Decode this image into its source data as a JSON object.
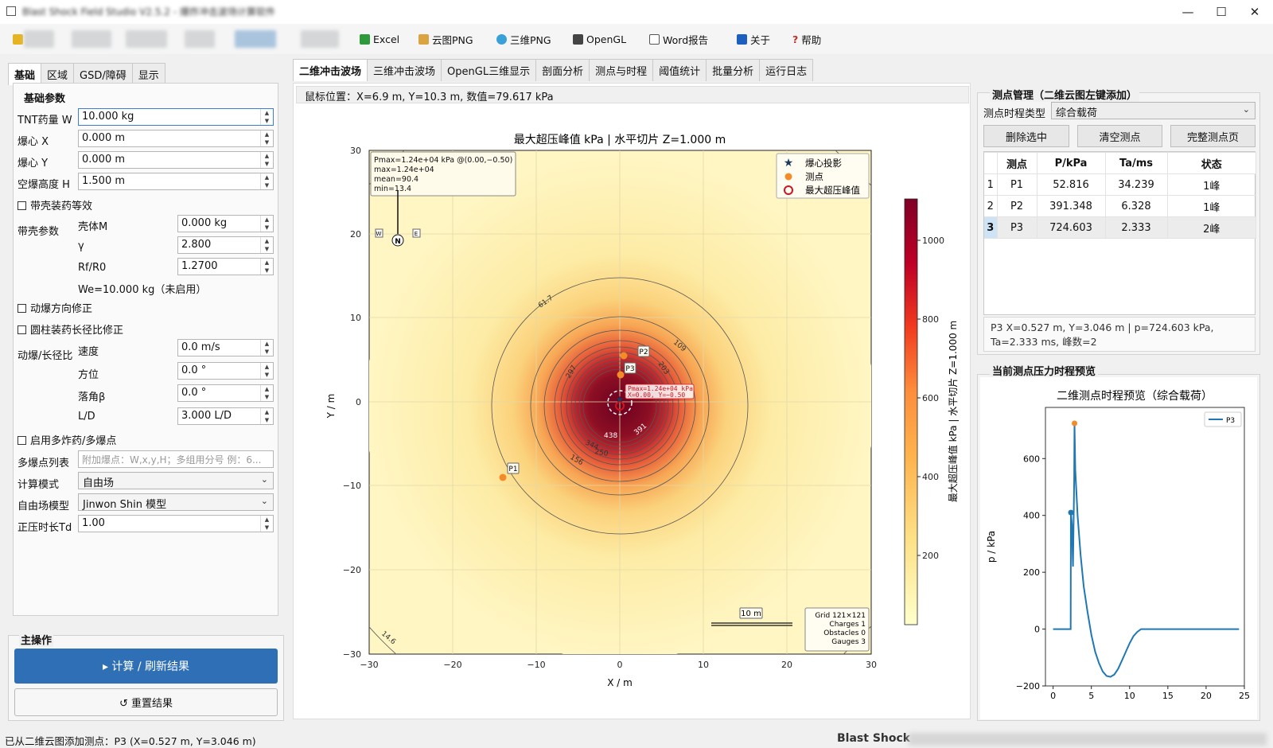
{
  "window": {
    "title": "Blast Shock Field Studio V2.5.2 - 爆炸冲击波场计算软件",
    "minimize": "—",
    "maximize": "☐",
    "close": "✕"
  },
  "toolbar": {
    "items": [
      "Excel",
      "云图PNG",
      "三维PNG",
      "OpenGL",
      "Word报告",
      "关于",
      "帮助"
    ]
  },
  "left": {
    "tabs": [
      "基础",
      "区域",
      "GSD/障碍",
      "显示"
    ],
    "group_basic": "基础参数",
    "tnt_label": "TNT药量 W",
    "tnt_value": "10.000 kg",
    "cx_label": "爆心 X",
    "cx_value": "0.000 m",
    "cy_label": "爆心 Y",
    "cy_value": "0.000 m",
    "h_label": "空爆高度 H",
    "h_value": "1.500 m",
    "shell_cb": "带壳装药等效",
    "shell_params": "带壳参数",
    "shell_m_label": "壳体M",
    "shell_m_value": "0.000 kg",
    "gamma_label": "γ",
    "gamma_value": "2.800",
    "rf_label": "Rf/R0",
    "rf_value": "1.2700",
    "we_text": "We=10.000 kg（未启用）",
    "dyn_cb": "动爆方向修正",
    "cyl_cb": "圆柱装药长径比修正",
    "dyn_group": "动爆/长径比",
    "speed_label": "速度",
    "speed_value": "0.0 m/s",
    "azimuth_label": "方位",
    "azimuth_value": "0.0 °",
    "fall_label": "落角β",
    "fall_value": "0.0 °",
    "ld_label": "L/D",
    "ld_value": "3.000 L/D",
    "multi_cb": "启用多炸药/多爆点",
    "multi_list_label": "多爆点列表",
    "multi_list_placeholder": "附加爆点：W,x,y,H；多组用分号 例：6...",
    "calc_mode_label": "计算模式",
    "calc_mode_value": "自由场",
    "free_model_label": "自由场模型",
    "free_model_value": "Jinwon Shin 模型",
    "td_label": "正压时长Td",
    "td_value": "1.00",
    "main_ops": "主操作",
    "calc_button": "▸  计算 / 刷新结果",
    "reset_button": "↺  重置结果"
  },
  "center": {
    "tabs": [
      "二维冲击波场",
      "三维冲击波场",
      "OpenGL三维显示",
      "剖面分析",
      "测点与时程",
      "阈值统计",
      "批量分析",
      "运行日志"
    ],
    "mouse_pos": "鼠标位置：X=6.9 m, Y=10.3 m, 数值=79.617 kPa"
  },
  "contour_plot": {
    "title": "最大超压峰值 kPa  |  水平切片 Z=1.000 m",
    "xlabel": "X / m",
    "ylabel": "Y / m",
    "xticks": [
      "−30",
      "−20",
      "−10",
      "0",
      "10",
      "20",
      "30"
    ],
    "yticks": [
      "30",
      "20",
      "10",
      "0",
      "−10",
      "−20",
      "−30"
    ],
    "colorbar_label": "最大超压峰值 kPa  |  水平切片 Z=1.000 m",
    "colorbar_ticks": [
      "1000",
      "800",
      "600",
      "400",
      "200"
    ],
    "contour_labels": [
      "61.7",
      "109",
      "203",
      "156",
      "250",
      "297",
      "344",
      "14.6",
      "391",
      "438"
    ],
    "legend": [
      "爆心投影",
      "测点",
      "最大超压峰值"
    ],
    "stats": [
      "Pmax=1.24e+04 kPa @(0.00,−0.50)",
      "max=1.24e+04",
      "mean=90.4",
      "min=13.4"
    ],
    "compass": [
      "W",
      "E",
      "N"
    ],
    "peak_label": [
      "Pmax=1.24e+04 kPa",
      "X=0.00, Y=−0.50"
    ],
    "gauge_labels": [
      "P1",
      "P2",
      "P3"
    ],
    "scale": "10 m",
    "info": [
      "Grid 121×121",
      "Charges 1",
      "Obstacles 0",
      "Gauges 3"
    ]
  },
  "right": {
    "title": "测点管理（二维云图左键添加）",
    "type_label": "测点时程类型",
    "type_value": "综合载荷",
    "btn_delete": "删除选中",
    "btn_clear": "清空测点",
    "btn_full": "完整测点页",
    "headers": [
      "测点",
      "P/kPa",
      "Ta/ms",
      "状态"
    ],
    "rows": [
      {
        "idx": "1",
        "name": "P1",
        "p": "52.816",
        "ta": "34.239",
        "state": "1峰"
      },
      {
        "idx": "2",
        "name": "P2",
        "p": "391.348",
        "ta": "6.328",
        "state": "1峰"
      },
      {
        "idx": "3",
        "name": "P3",
        "p": "724.603",
        "ta": "2.333",
        "state": "2峰"
      }
    ],
    "detail_1": "P3  X=0.527 m, Y=3.046 m  |  p=724.603 kPa,",
    "detail_2": "Ta=2.333 ms, 峰数=2",
    "preview_title": "当前测点压力时程预览"
  },
  "chart_data": {
    "type": "line",
    "title": "二维测点时程预览（综合载荷）",
    "xlabel": "",
    "ylabel": "p / kPa",
    "xlim": [
      -1,
      25
    ],
    "ylim": [
      -200,
      780
    ],
    "xticks": [
      0,
      5,
      10,
      15,
      20,
      25
    ],
    "yticks": [
      -200,
      0,
      200,
      400,
      600
    ],
    "series": [
      {
        "name": "P3",
        "color": "#1f77b4",
        "x": [
          0,
          2.3,
          2.33,
          2.45,
          2.6,
          2.75,
          2.8,
          2.9,
          3.2,
          3.6,
          4.0,
          4.5,
          5.0,
          5.5,
          6.0,
          6.5,
          7.0,
          7.5,
          8.0,
          8.5,
          9.0,
          9.5,
          10.0,
          10.5,
          11.0,
          11.5,
          12.0,
          13.0,
          15,
          20,
          24.3
        ],
        "y": [
          0,
          0,
          410,
          370,
          220,
          520,
          724,
          560,
          400,
          260,
          150,
          60,
          -20,
          -80,
          -120,
          -150,
          -165,
          -168,
          -160,
          -140,
          -110,
          -80,
          -50,
          -25,
          -10,
          0,
          0,
          0,
          0,
          0,
          0
        ]
      }
    ],
    "markers": [
      {
        "x": 2.33,
        "y": 410
      },
      {
        "x": 2.8,
        "y": 724
      }
    ]
  },
  "status": {
    "left": "已从二维云图添加测点：P3 (X=0.527 m, Y=3.046 m)",
    "right": "Blast Shock"
  }
}
